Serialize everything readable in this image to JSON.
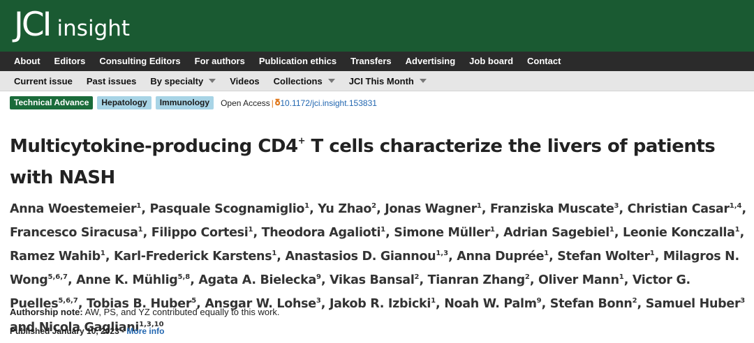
{
  "logo": {
    "main": "JCI",
    "sub": "insight"
  },
  "nav_primary": [
    "About",
    "Editors",
    "Consulting Editors",
    "For authors",
    "Publication ethics",
    "Transfers",
    "Advertising",
    "Job board",
    "Contact"
  ],
  "nav_secondary": [
    {
      "label": "Current issue",
      "dropdown": false
    },
    {
      "label": "Past issues",
      "dropdown": false
    },
    {
      "label": "By specialty",
      "dropdown": true
    },
    {
      "label": "Videos",
      "dropdown": false
    },
    {
      "label": "Collections",
      "dropdown": true
    },
    {
      "label": "JCI This Month",
      "dropdown": true
    }
  ],
  "tags": {
    "article_type": "Technical Advance",
    "specialties": [
      "Hepatology",
      "Immunology"
    ],
    "open_access": "Open Access",
    "separator": "|",
    "doi": "10.1172/jci.insight.153831"
  },
  "article": {
    "title_before": "Multicytokine-producing CD4",
    "title_sup": "+",
    "title_after": " T cells characterize the livers of patients with NASH",
    "authors": [
      {
        "name": "Anna Woestemeier",
        "aff": "1"
      },
      {
        "name": "Pasquale Scognamiglio",
        "aff": "1"
      },
      {
        "name": "Yu Zhao",
        "aff": "2"
      },
      {
        "name": "Jonas Wagner",
        "aff": "1"
      },
      {
        "name": "Franziska Muscate",
        "aff": "3"
      },
      {
        "name": "Christian Casar",
        "aff": "1,4"
      },
      {
        "name": "Francesco Siracusa",
        "aff": "1"
      },
      {
        "name": "Filippo Cortesi",
        "aff": "1"
      },
      {
        "name": "Theodora Agalioti",
        "aff": "1"
      },
      {
        "name": "Simone Müller",
        "aff": "1"
      },
      {
        "name": "Adrian Sagebiel",
        "aff": "1"
      },
      {
        "name": "Leonie Konczalla",
        "aff": "1"
      },
      {
        "name": "Ramez Wahib",
        "aff": "1"
      },
      {
        "name": "Karl-Frederick Karstens",
        "aff": "1"
      },
      {
        "name": "Anastasios D. Giannou",
        "aff": "1,3"
      },
      {
        "name": "Anna Duprée",
        "aff": "1"
      },
      {
        "name": "Stefan Wolter",
        "aff": "1"
      },
      {
        "name": "Milagros N. Wong",
        "aff": "5,6,7"
      },
      {
        "name": "Anne K. Mühlig",
        "aff": "5,8"
      },
      {
        "name": "Agata A. Bielecka",
        "aff": "9"
      },
      {
        "name": "Vikas Bansal",
        "aff": "2"
      },
      {
        "name": "Tianran Zhang",
        "aff": "2"
      },
      {
        "name": "Oliver Mann",
        "aff": "1"
      },
      {
        "name": "Victor G. Puelles",
        "aff": "5,6,7"
      },
      {
        "name": "Tobias B. Huber",
        "aff": "5"
      },
      {
        "name": "Ansgar W. Lohse",
        "aff": "3"
      },
      {
        "name": "Jakob R. Izbicki",
        "aff": "1"
      },
      {
        "name": "Noah W. Palm",
        "aff": "9"
      },
      {
        "name": "Stefan Bonn",
        "aff": "2"
      },
      {
        "name": "Samuel Huber",
        "aff": "3"
      },
      {
        "name": "Nicola Gagliani",
        "aff": "1,3,10"
      }
    ],
    "author_conjunction": "and",
    "authorship_note_label": "Authorship note:",
    "authorship_note_text": " AW, PS, and YZ contributed equally to this work.",
    "published": "Published January 10, 2023 - ",
    "more_info": "More info"
  },
  "colors": {
    "header": "#1a5a32",
    "nav": "#2b2b2b",
    "subnav": "#e6e6e6",
    "tag_type": "#1a6b3a",
    "tag_specialty": "#a8d4e6",
    "link": "#2166b0",
    "accent": "#e07a1f"
  }
}
